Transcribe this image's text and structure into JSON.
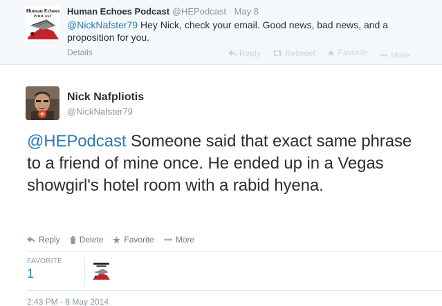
{
  "parent_tweet": {
    "name": "Human Echoes Podcast",
    "handle": "@HEPodcast",
    "dot": "·",
    "time": "May 8",
    "mention": "@NickNafster79",
    "text": "Hey Nick, check your email. Good news, bad news, and a proposition for you.",
    "details": "Details",
    "actions": {
      "reply": "Reply",
      "retweet": "Retweet",
      "favorite": "Favorite",
      "more": "More"
    },
    "avatar_logo_line1": "Human Echoes",
    "avatar_logo_line2": "PODCAST"
  },
  "main_tweet": {
    "name": "Nick Nafpliotis",
    "handle": "@NickNafster79",
    "mention": "@HEPodcast",
    "text": "Someone said that exact same phrase to a friend of mine once. He ended up in a Vegas showgirl's hotel room with a rabid hyena.",
    "actions": {
      "reply": "Reply",
      "delete": "Delete",
      "favorite": "Favorite",
      "more": "More"
    },
    "stats": {
      "label": "FAVORITE",
      "count": "1"
    },
    "timestamp": "2:43 PM - 8 May 2014"
  },
  "colors": {
    "link": "#2b7bb9",
    "muted": "#8899a6",
    "parent_bg": "#f5f8fa",
    "logo_red": "#c0252b"
  }
}
